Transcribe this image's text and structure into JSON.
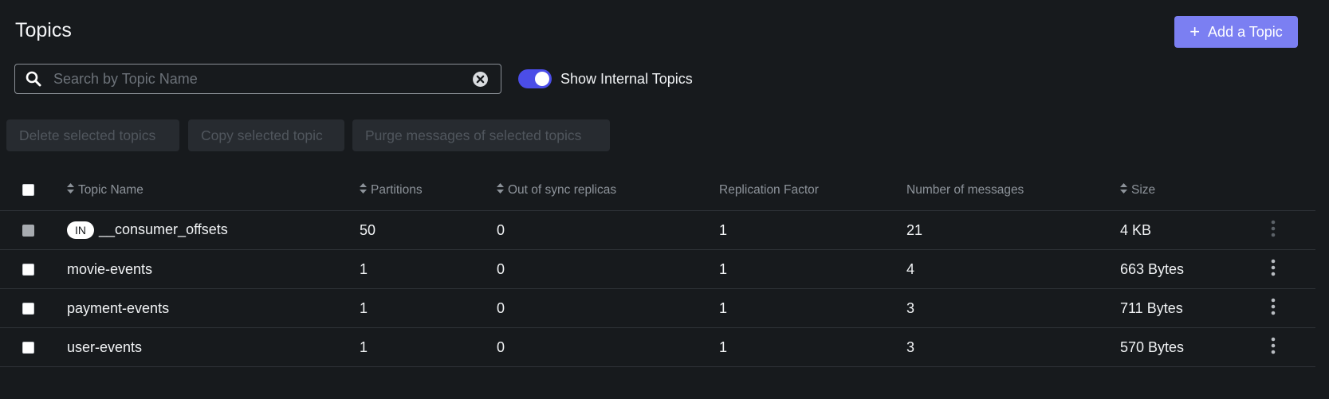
{
  "header": {
    "title": "Topics",
    "add_button_label": "Add a Topic"
  },
  "search": {
    "placeholder": "Search by Topic Name",
    "value": ""
  },
  "toggle": {
    "label": "Show Internal Topics",
    "checked": true
  },
  "bulk_actions": [
    {
      "label": "Delete selected topics"
    },
    {
      "label": "Copy selected topic"
    },
    {
      "label": "Purge messages of selected topics"
    }
  ],
  "table": {
    "columns": [
      {
        "label": "Topic Name",
        "sortable": true
      },
      {
        "label": "Partitions",
        "sortable": true
      },
      {
        "label": "Out of sync replicas",
        "sortable": true
      },
      {
        "label": "Replication Factor",
        "sortable": false
      },
      {
        "label": "Number of messages",
        "sortable": false
      },
      {
        "label": "Size",
        "sortable": true
      }
    ],
    "rows": [
      {
        "internal_badge": "IN",
        "name": "__consumer_offsets",
        "partitions": "50",
        "out_of_sync": "0",
        "replication_factor": "1",
        "messages": "21",
        "size": "4 KB",
        "checkbox_disabled": true
      },
      {
        "internal_badge": "",
        "name": "movie-events",
        "partitions": "1",
        "out_of_sync": "0",
        "replication_factor": "1",
        "messages": "4",
        "size": "663 Bytes",
        "checkbox_disabled": false
      },
      {
        "internal_badge": "",
        "name": "payment-events",
        "partitions": "1",
        "out_of_sync": "0",
        "replication_factor": "1",
        "messages": "3",
        "size": "711 Bytes",
        "checkbox_disabled": false
      },
      {
        "internal_badge": "",
        "name": "user-events",
        "partitions": "1",
        "out_of_sync": "0",
        "replication_factor": "1",
        "messages": "3",
        "size": "570 Bytes",
        "checkbox_disabled": false
      }
    ]
  },
  "colors": {
    "background": "#171a1d",
    "accent": "#7b7ff2",
    "toggle_on": "#4b4de8"
  }
}
